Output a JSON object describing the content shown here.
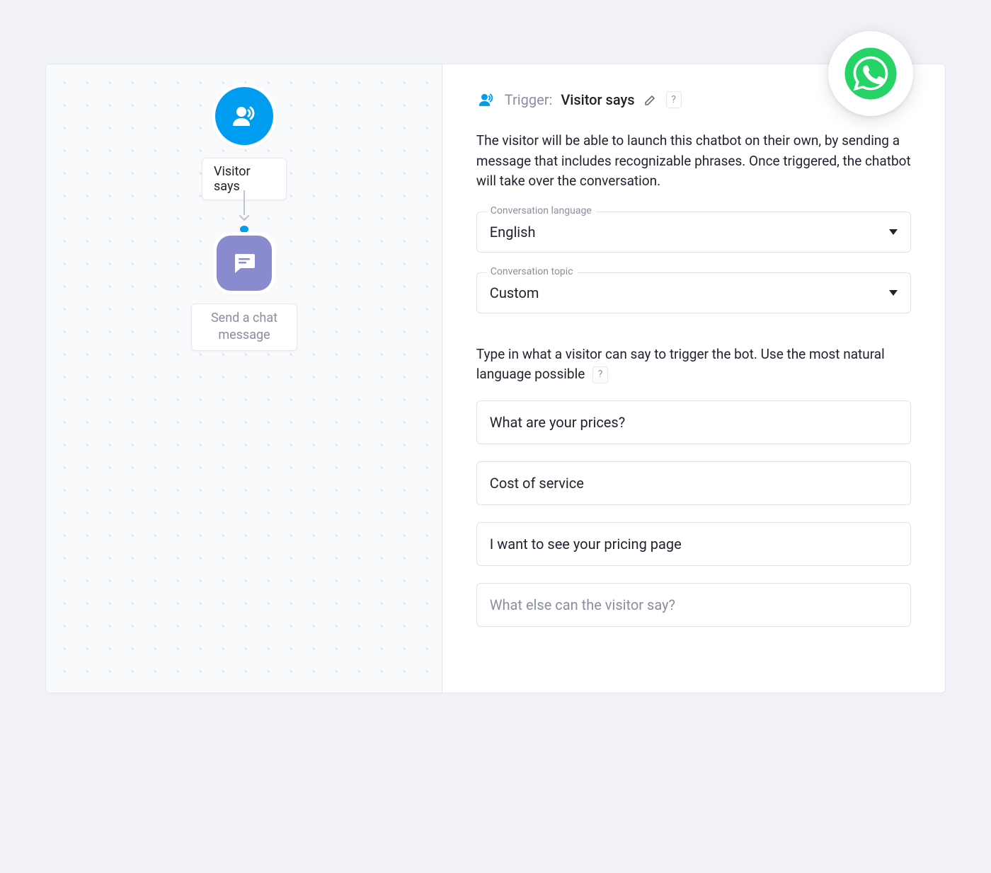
{
  "flow": {
    "trigger_label": "Visitor says",
    "action_label": "Send a chat message"
  },
  "panel": {
    "trigger_prefix": "Trigger:",
    "trigger_name": "Visitor says",
    "help": "?",
    "description": "The visitor will be able to launch this chatbot on their own, by sending a message that includes recognizable phrases. Once triggered, the chatbot will take over the conversation.",
    "language_field_label": "Conversation language",
    "language_value": "English",
    "topic_field_label": "Conversation topic",
    "topic_value": "Custom",
    "phrase_prompt": "Type in what a visitor can say to trigger the bot. Use the most natural language possible",
    "phrases": [
      "What are your prices?",
      "Cost of service",
      "I want to see your pricing page"
    ],
    "phrase_placeholder": "What else can the visitor say?"
  }
}
